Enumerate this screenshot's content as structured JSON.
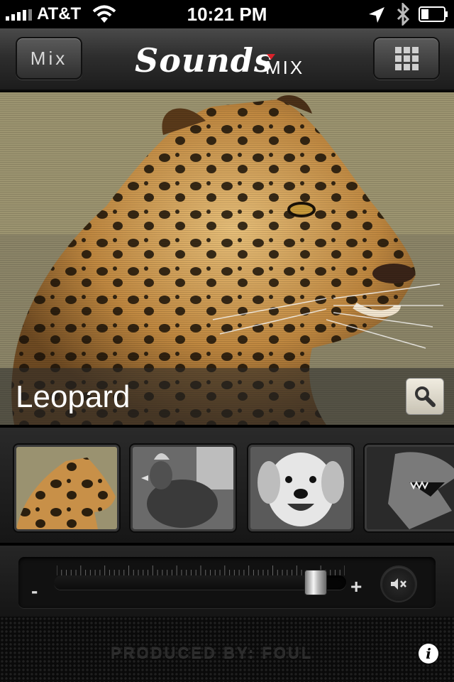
{
  "status_bar": {
    "carrier": "AT&T",
    "time": "10:21 PM"
  },
  "navbar": {
    "mix_button_label": "Mix",
    "logo_main": "Sounds",
    "logo_sub": "MIX",
    "grid_button_icon": "grid-icon"
  },
  "hero": {
    "title": "Leopard",
    "search_icon": "search-icon"
  },
  "thumbnails": [
    {
      "name": "leopard"
    },
    {
      "name": "rooster"
    },
    {
      "name": "dog"
    },
    {
      "name": "dinosaur"
    }
  ],
  "volume": {
    "minus_label": "-",
    "plus_label": "+",
    "level": 0.93,
    "mute_icon": "mute-icon"
  },
  "footer": {
    "produced_by": "PRODUCED BY: FOUL",
    "info_label": "i"
  }
}
